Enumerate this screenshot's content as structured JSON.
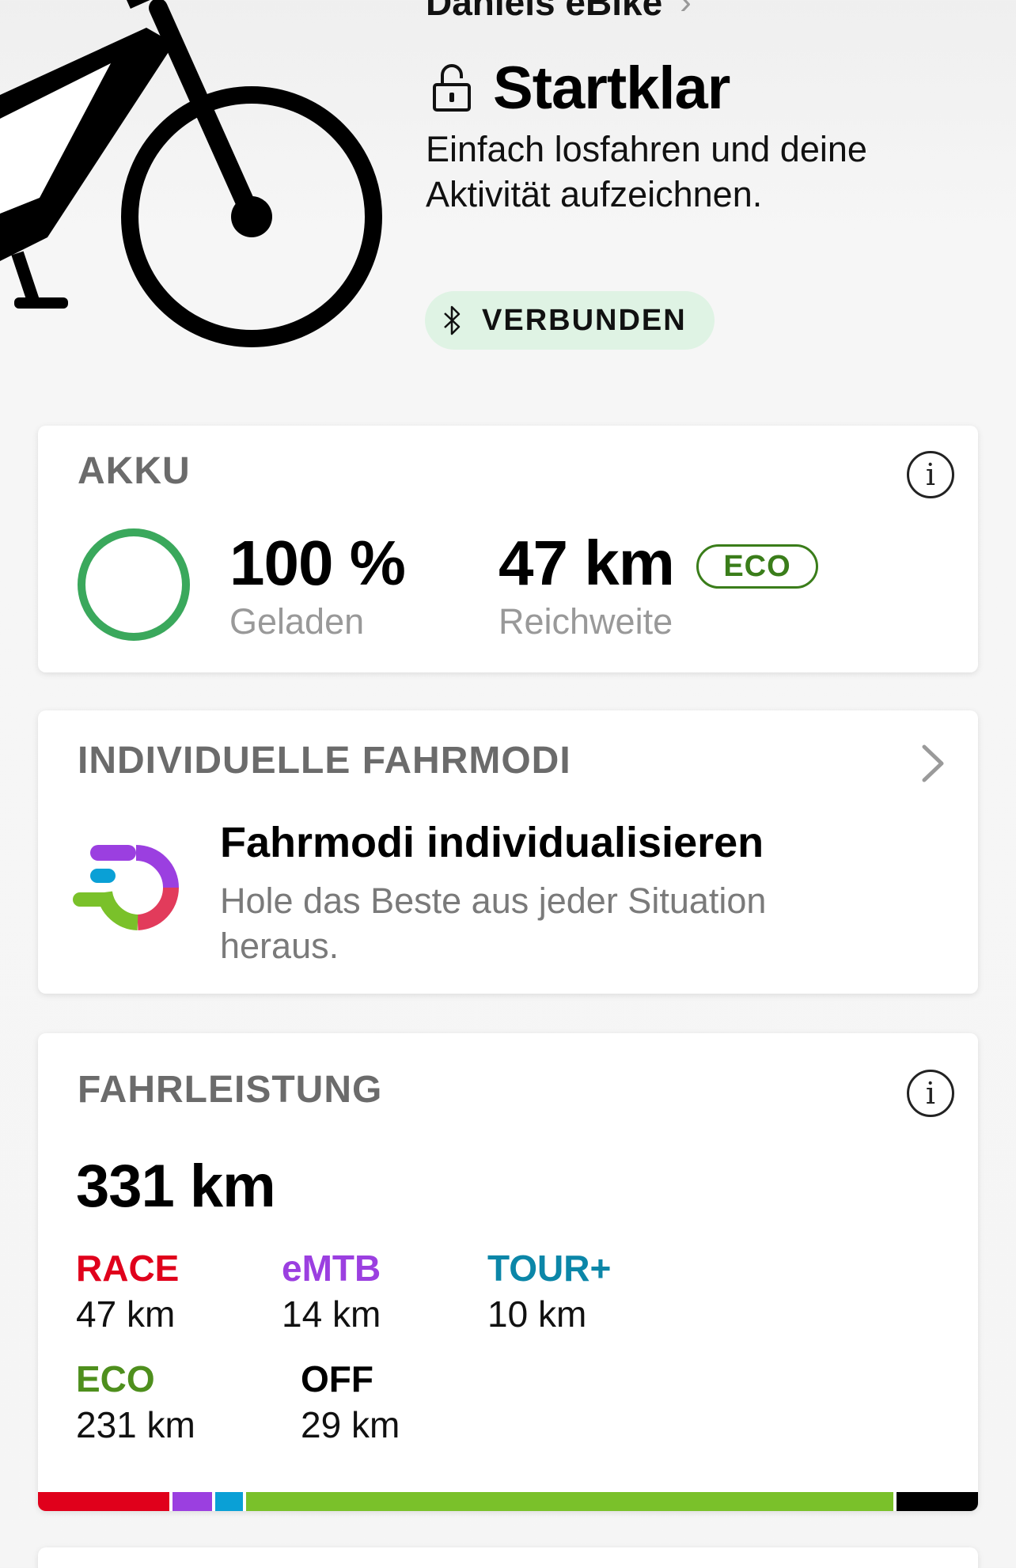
{
  "header": {
    "bike_name": "Daniels eBike",
    "chevron": "›",
    "status_title": "Startklar",
    "status_description": "Einfach losfahren und deine Aktivität aufzeichnen.",
    "connection_label": "VERBUNDEN",
    "icons": {
      "lock": "unlocked-padlock-icon",
      "bluetooth": "bluetooth-icon"
    }
  },
  "battery": {
    "title": "AKKU",
    "info_icon": "i",
    "charge_value": "100 %",
    "charge_label": "Geladen",
    "charge_fraction": 1.0,
    "range_value": "47 km",
    "range_label": "Reichweite",
    "range_mode": "ECO",
    "colors": {
      "ring": "#3aa85c",
      "eco": "#3a7d1a"
    }
  },
  "ride_modes_promo": {
    "title": "INDIVIDUELLE FAHRMODI",
    "headline": "Fahrmodi individualisieren",
    "description": "Hole das Beste aus jeder Situation heraus."
  },
  "performance": {
    "title": "FAHRLEISTUNG",
    "info_icon": "i",
    "total": "331 km",
    "modes": [
      {
        "name": "RACE",
        "distance": "47 km",
        "km": 47,
        "color": "#e0001b"
      },
      {
        "name": "eMTB",
        "distance": "14 km",
        "km": 14,
        "color": "#9b3fe0"
      },
      {
        "name": "TOUR+",
        "distance": "10 km",
        "km": 10,
        "color": "#0b86a8"
      },
      {
        "name": "ECO",
        "distance": "231 km",
        "km": 231,
        "color": "#4e8f1d"
      },
      {
        "name": "OFF",
        "distance": "29 km",
        "km": 29,
        "color": "#000000"
      }
    ],
    "bar_colors": [
      "#e0001b",
      "#9b3fe0",
      "#0aa0d6",
      "#7ac12a",
      "#000000"
    ]
  }
}
